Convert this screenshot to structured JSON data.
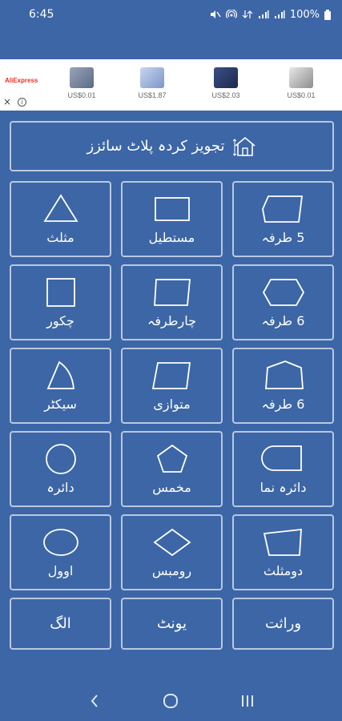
{
  "status_bar": {
    "time": "6:45",
    "battery": "100%"
  },
  "ad": {
    "brand": "AliExpress",
    "items": [
      {
        "price": "US$0.01"
      },
      {
        "price": "US$1.87"
      },
      {
        "price": "US$2.03"
      },
      {
        "price": "US$0.01"
      }
    ],
    "close_glyph": "×",
    "info_glyph": "i"
  },
  "header": {
    "label": "تجویز کردہ پلاٹ سائزز",
    "icon": "house-icon"
  },
  "shapes": [
    {
      "label": "5 طرفہ",
      "icon": "pentagon-irregular-icon"
    },
    {
      "label": "مستطیل",
      "icon": "rectangle-icon"
    },
    {
      "label": "مثلث",
      "icon": "triangle-icon"
    },
    {
      "label": "6 طرفہ",
      "icon": "hexagon-icon"
    },
    {
      "label": "چارطرفہ",
      "icon": "quadrilateral-icon"
    },
    {
      "label": "چکور",
      "icon": "square-icon"
    },
    {
      "label": "6 طرفہ",
      "icon": "hexagon-irregular-icon"
    },
    {
      "label": "متوازی",
      "icon": "parallelogram-icon"
    },
    {
      "label": "سیکٹر",
      "icon": "sector-icon"
    },
    {
      "label": "دائرہ نما",
      "icon": "rounded-rectangle-icon"
    },
    {
      "label": "مخمس",
      "icon": "pentagon-icon"
    },
    {
      "label": "دائرہ",
      "icon": "circle-icon"
    },
    {
      "label": "دومثلث",
      "icon": "trapezoid-icon"
    },
    {
      "label": "رومبس",
      "icon": "rhombus-icon"
    },
    {
      "label": "اوول",
      "icon": "oval-icon"
    }
  ],
  "bottom_buttons": [
    {
      "label": "وراثت"
    },
    {
      "label": "یونٹ"
    },
    {
      "label": "الگ"
    }
  ],
  "colors": {
    "background": "#3c66a6",
    "border": "#b9c8e2",
    "text": "#ffffff"
  }
}
